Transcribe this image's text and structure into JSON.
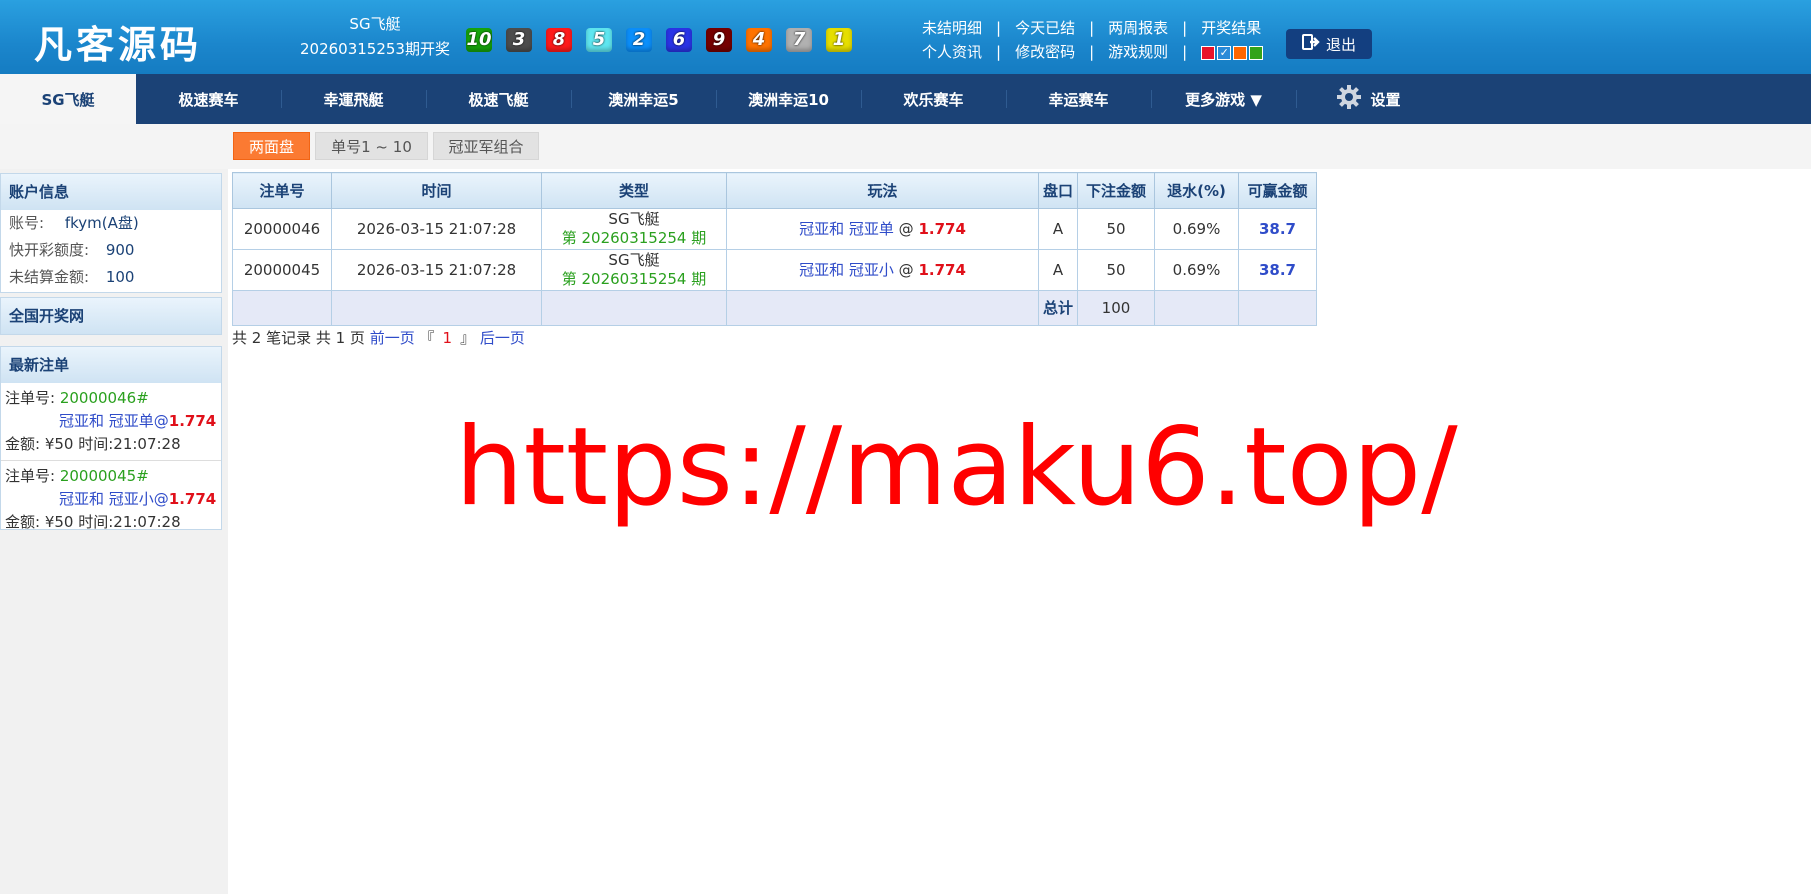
{
  "header": {
    "logo": "凡客源码",
    "draw_game": "SG飞艇",
    "draw_period": "20260315253期开奖",
    "balls": [
      {
        "num": "10",
        "cls": "b10"
      },
      {
        "num": "3",
        "cls": "b3"
      },
      {
        "num": "8",
        "cls": "b8"
      },
      {
        "num": "5",
        "cls": "b5"
      },
      {
        "num": "2",
        "cls": "b2"
      },
      {
        "num": "6",
        "cls": "b6"
      },
      {
        "num": "9",
        "cls": "b9"
      },
      {
        "num": "4",
        "cls": "b4"
      },
      {
        "num": "7",
        "cls": "b7"
      },
      {
        "num": "1",
        "cls": "b1"
      }
    ],
    "links_row1": [
      "未结明细",
      "今天已结",
      "两周报表",
      "开奖结果"
    ],
    "links_row2": [
      "个人资讯",
      "修改密码",
      "游戏规则"
    ],
    "separator": "|",
    "theme_swatches": [
      "#e8132a",
      "#2a8ad8",
      "#ff6600",
      "#33a31a"
    ],
    "logout_label": "退出"
  },
  "nav": {
    "items": [
      "SG飞艇",
      "极速赛车",
      "幸運飛艇",
      "极速飞艇",
      "澳洲幸运5",
      "澳洲幸运10",
      "欢乐赛车",
      "幸运赛车",
      "更多游戏 ▼"
    ],
    "settings_label": "设置"
  },
  "subtabs": [
    "两面盘",
    "单号1 ~ 10",
    "冠亚军组合"
  ],
  "sidebar": {
    "account_title": "账户信息",
    "account_label": "账号:",
    "account_value": "fkym(A盘)",
    "quota_label": "快开彩额度:",
    "quota_value": "900",
    "unsettled_label": "未结算金额:",
    "unsettled_value": "100",
    "lottery_site_title": "全国开奖网",
    "recent_title": "最新注单",
    "recent_orders": [
      {
        "label": "注单号:",
        "id": "20000046#",
        "play": "冠亚和 冠亚单",
        "at": "@",
        "odds": "1.774",
        "amount_text": "金额: ¥50  时间:21:07:28"
      },
      {
        "label": "注单号:",
        "id": "20000045#",
        "play": "冠亚和 冠亚小",
        "at": "@",
        "odds": "1.774",
        "amount_text": "金额: ¥50  时间:21:07:28"
      }
    ]
  },
  "table": {
    "headers": [
      "注单号",
      "时间",
      "类型",
      "玩法",
      "盘口",
      "下注金额",
      "退水(%)",
      "可赢金额"
    ],
    "rows": [
      {
        "id": "20000046",
        "time": "2026-03-15 21:07:28",
        "game": "SG飞艇",
        "period": "第 20260315254 期",
        "play": "冠亚和 冠亚单",
        "at": "@",
        "odds": "1.774",
        "market": "A",
        "amount": "50",
        "rebate": "0.69%",
        "win": "38.7"
      },
      {
        "id": "20000045",
        "time": "2026-03-15 21:07:28",
        "game": "SG飞艇",
        "period": "第 20260315254 期",
        "play": "冠亚和 冠亚小",
        "at": "@",
        "odds": "1.774",
        "market": "A",
        "amount": "50",
        "rebate": "0.69%",
        "win": "38.7"
      }
    ],
    "total_label": "总计",
    "total_amount": "100"
  },
  "pager": {
    "summary": "共 2 笔记录 共 1 页",
    "prev": "前一页",
    "open_bracket": "『",
    "current": "1",
    "close_bracket": "』",
    "next": "后一页"
  },
  "watermark": "https://maku6.top/"
}
